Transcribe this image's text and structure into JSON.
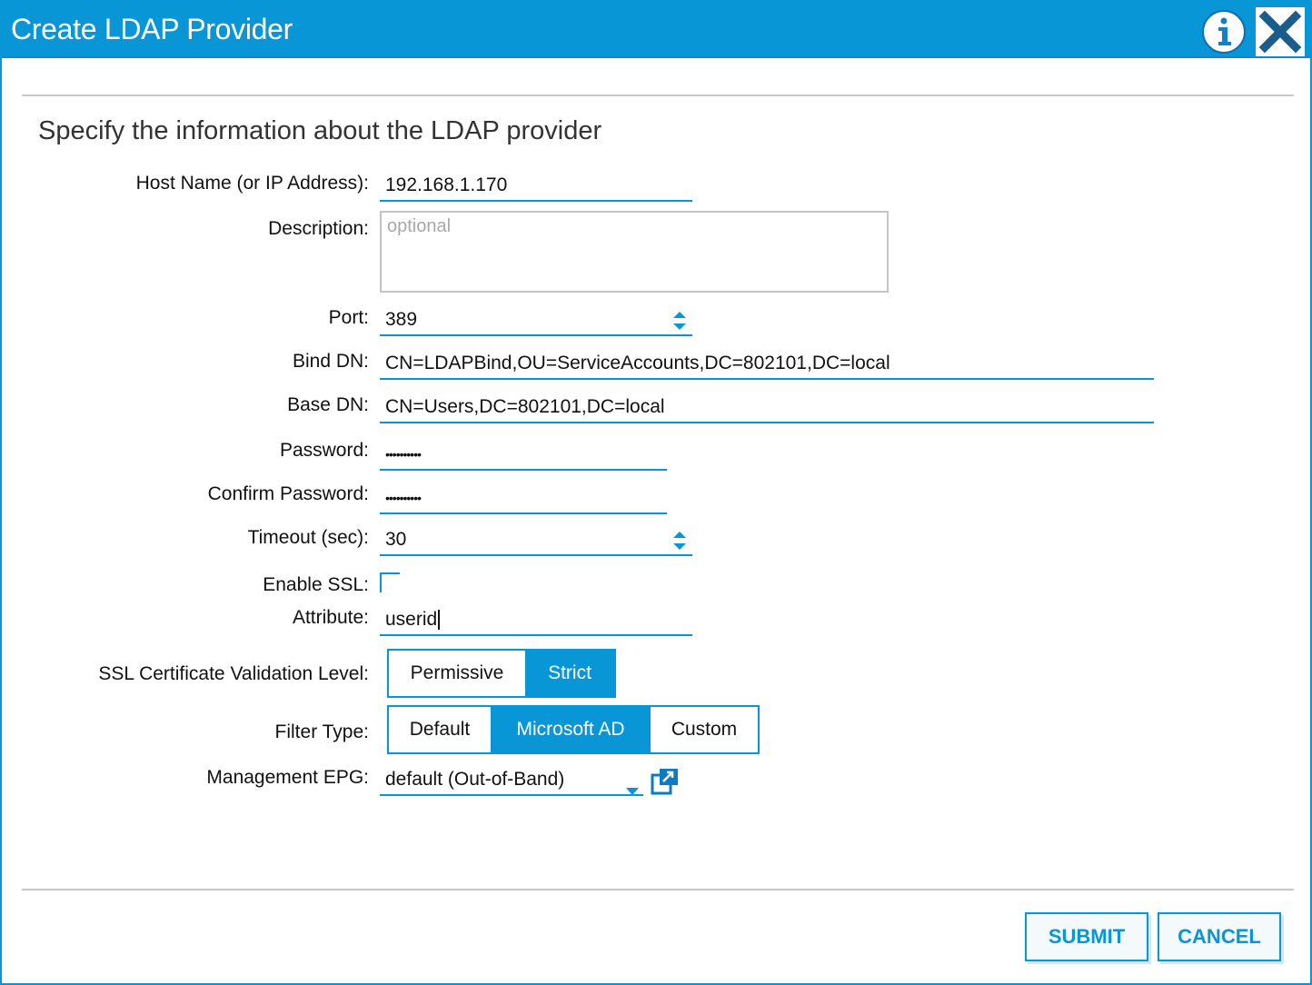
{
  "dialog": {
    "title": "Create LDAP Provider",
    "heading": "Specify the information about the LDAP provider"
  },
  "icons": {
    "info": "info-icon",
    "close": "close-icon",
    "spinner": "up-down-spinner-icon",
    "dropdown": "chevron-down-icon",
    "popup": "open-popup-icon"
  },
  "form": {
    "host": {
      "label": "Host Name (or IP Address):",
      "value": "192.168.1.170"
    },
    "description": {
      "label": "Description:",
      "placeholder": "optional",
      "value": ""
    },
    "port": {
      "label": "Port:",
      "value": "389"
    },
    "bind_dn": {
      "label": "Bind DN:",
      "value": "CN=LDAPBind,OU=ServiceAccounts,DC=802101,DC=local"
    },
    "base_dn": {
      "label": "Base DN:",
      "value": "CN=Users,DC=802101,DC=local"
    },
    "password": {
      "label": "Password:",
      "value": "••••••••••"
    },
    "confirm_password": {
      "label": "Confirm Password:",
      "value": "••••••••••"
    },
    "timeout": {
      "label": "Timeout (sec):",
      "value": "30"
    },
    "enable_ssl": {
      "label": "Enable SSL:",
      "checked": false
    },
    "attribute": {
      "label": "Attribute:",
      "value": "userid"
    },
    "ssl_validation": {
      "label": "SSL Certificate Validation Level:",
      "options": [
        "Permissive",
        "Strict"
      ],
      "selected": "Strict"
    },
    "filter_type": {
      "label": "Filter Type:",
      "options": [
        "Default",
        "Microsoft AD",
        "Custom"
      ],
      "selected": "Microsoft AD"
    },
    "management_epg": {
      "label": "Management EPG:",
      "value": "default (Out-of-Band)"
    }
  },
  "footer": {
    "submit": "SUBMIT",
    "cancel": "CANCEL"
  },
  "colors": {
    "accent": "#0996d7"
  }
}
